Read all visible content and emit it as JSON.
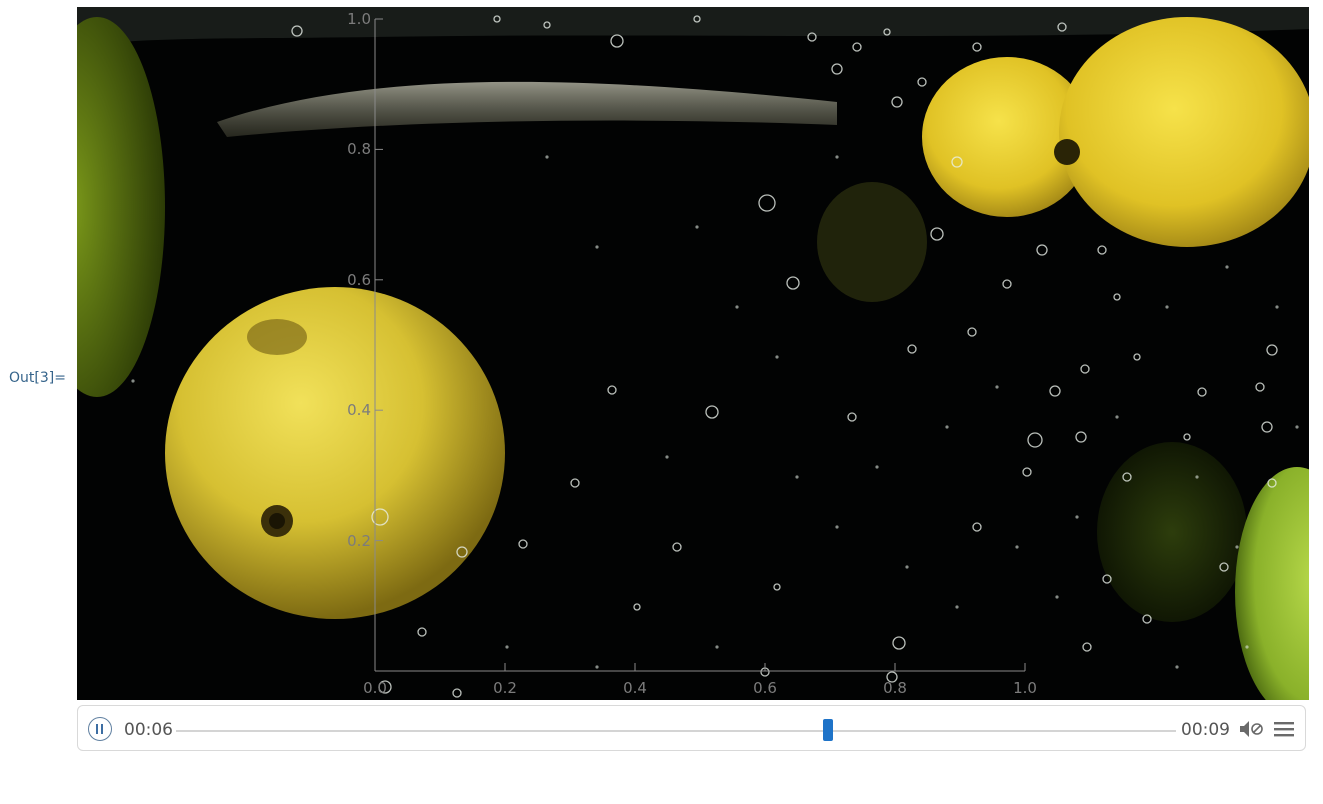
{
  "cell": {
    "out_label": "Out[3]="
  },
  "plot_axes": {
    "x_ticks": [
      "0.0",
      "0.2",
      "0.4",
      "0.6",
      "0.8",
      "1.0"
    ],
    "y_ticks": [
      "0.2",
      "0.4",
      "0.6",
      "0.8",
      "1.0"
    ],
    "axis_color": "#8a8a8a"
  },
  "player": {
    "state": "playing",
    "current_time": "00:06",
    "duration": "00:09",
    "progress": 0.652,
    "pause_icon": "pause-icon",
    "mute_icon": "speaker-muted-icon",
    "menu_icon": "hamburger-menu-icon",
    "accent_color": "#1e73c8"
  }
}
